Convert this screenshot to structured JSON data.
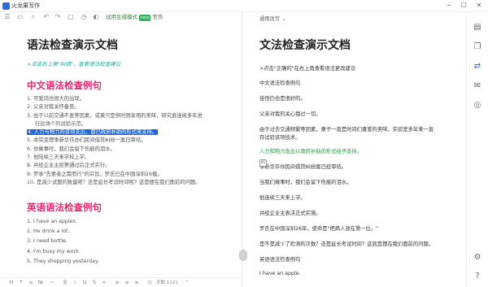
{
  "window": {
    "title": "火龙果写作",
    "buttons": {
      "minimize": "─",
      "maximize": "☐",
      "close": "✕"
    }
  },
  "left": {
    "toolbar": {
      "mode_chip_label": "试用生成模式",
      "mode_badge": "new",
      "mode_suffix": "写作"
    },
    "doc_title": "语法检查演示文档",
    "tip": ">点击右上角\"纠错\"，查看语法检查建议",
    "cn_heading": "中文语法检查例句",
    "cn_items": [
      "1. 可爱鸽也很大的出现。",
      "2. 父亲对我关怀备至。",
      "3. 由于以前交通不发等因素，或黄只是供时困享用的美味，研究直连续多年进",
      "行远场个的试验示范。",
      "4. 人力与物力的资项支出，都已政府补助的形式来支持。",
      "5. 本院变理季新华许办们民间借贷纠纷一案已审结。",
      "6. 你做事时，我们会留下伤痕的泪水。",
      "7. 他陆续三天来学校上学。",
      "8. 并经企业主投票通过后正式实行。",
      "9. 罗承\"先要者之需而行\"的宗旨，罗氏已在中国深圳26载。",
      "10. 是减少试题的数量呢？还是延长考试时间呢？这是摆在我们面前的问题。"
    ],
    "en_heading": "英语语法检查例句",
    "en_items": [
      "1. I have an apples.",
      "2. He drink a lot.",
      "3. I need bottle.",
      "4. I'm busy my work.",
      "5. They shopping yesterday."
    ],
    "status": {
      "word_count": "字数 1141",
      "zoom": "字"
    }
  },
  "right": {
    "preset": "通用改写",
    "title": "文法检查演示文档",
    "lines": [
      ">点击\"正确的\"在右上角查看语法更改建议",
      "中文语法检查例句",
      "佳怪仍也是很好的。",
      "父亲对我的关心我过一切。",
      "由于过去交通频繁等因素，栗子一直是时间们喜爱的美味，实验室多年来一直",
      "存试验该项技术。",
      "人力和物力支出以政府补贴的形式给予支持。",
      "季新华许你民间借贷纠纷案已经审结。",
      "当我们做事时，我们会留下伤痕的泪水。",
      "他连续三天来上学。",
      "并经企业主表决正式实施。",
      "罗氏在中国深圳26年，使命是\"把病人放在第一位。\"",
      "是不是减少了检测的次数？还是延长考试时间？这就是摆在我们面前的问题。",
      "英语语法检查例句",
      "I have an apple."
    ],
    "error_marker": "纠"
  },
  "sidebar": {
    "icons": [
      "document-icon",
      "copy-icon",
      "translate-icon",
      "mail-icon",
      "compass-icon",
      "settings-icon",
      "help-icon"
    ]
  }
}
